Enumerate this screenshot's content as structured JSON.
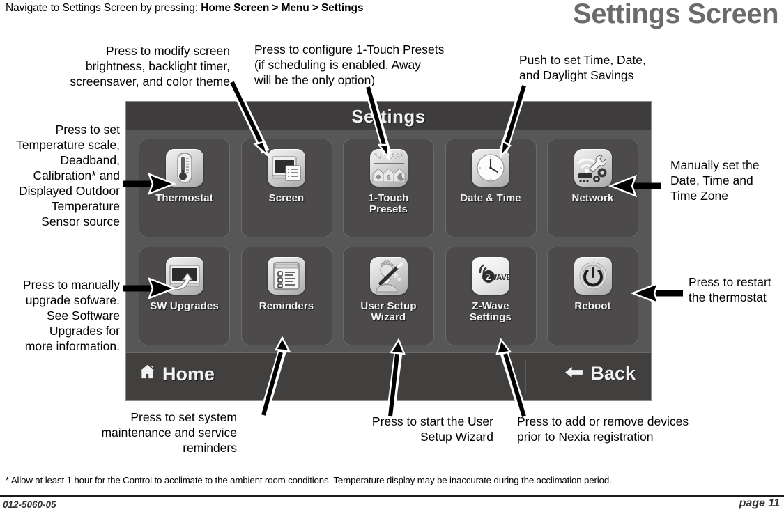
{
  "nav": {
    "prefix": "Navigate to Settings Screen by pressing:",
    "breadcrumb": "Home Screen > Menu > Settings"
  },
  "page": {
    "title": "Settings Screen",
    "footnote": "* Allow at least 1 hour for the Control to acclimate to the ambient room conditions.  Temperature display may be inaccurate during the acclimation period.",
    "doc_id": "012-5060-05",
    "page_number": "page 11"
  },
  "device": {
    "header_title": "Settings",
    "footer": {
      "home_label": "Home",
      "back_label": "Back",
      "home_icon": "home-icon",
      "back_icon": "arrow-left-icon"
    },
    "tiles": [
      {
        "id": "thermostat",
        "label": "Thermostat",
        "icon": "thermometer-icon"
      },
      {
        "id": "screen",
        "label": "Screen",
        "icon": "display-icon"
      },
      {
        "id": "one-touch",
        "label": "1-Touch\nPresets",
        "icon": "one-touch-presets-icon",
        "temp_high": "74°",
        "temp_low": "68°"
      },
      {
        "id": "date-time",
        "label": "Date & Time",
        "icon": "clock-icon"
      },
      {
        "id": "network",
        "label": "Network",
        "icon": "wifi-wrench-gear-icon"
      },
      {
        "id": "sw-upgrades",
        "label": "SW Upgrades",
        "icon": "screen-upload-arrow-icon"
      },
      {
        "id": "reminders",
        "label": "Reminders",
        "icon": "checklist-icon"
      },
      {
        "id": "user-wizard",
        "label": "User Setup\nWizard",
        "icon": "wizard-person-icon"
      },
      {
        "id": "z-wave",
        "label": "Z-Wave\nSettings",
        "icon": "z-wave-icon",
        "badge": "Z",
        "badge_text": "WAVE"
      },
      {
        "id": "reboot",
        "label": "Reboot",
        "icon": "power-icon"
      }
    ]
  },
  "callouts": [
    {
      "id": "screen",
      "text": "Press to modify screen\nbrightness, backlight timer,\nscreensaver, and color theme"
    },
    {
      "id": "one-touch",
      "text": "Press to configure 1-Touch Presets\n(if scheduling is enabled, Away\nwill be the only option)"
    },
    {
      "id": "date-time",
      "text": "Push to set Time, Date,\nand Daylight Savings"
    },
    {
      "id": "thermostat",
      "text": "Press to set\nTemperature  scale,\nDeadband,\nCalibration* and\nDisplayed Outdoor\nTemperature\nSensor source"
    },
    {
      "id": "network",
      "text": "Manually set the\nDate, Time and\nTime Zone"
    },
    {
      "id": "sw-upgrades",
      "text": "Press to manually\nupgrade sofware.\nSee Software\nUpgrades for\nmore information."
    },
    {
      "id": "reboot",
      "text": "Press to restart\nthe thermostat"
    },
    {
      "id": "reminders",
      "text": "Press to set system\nmaintenance and service\nreminders"
    },
    {
      "id": "user-wizard",
      "text": "Press to start the User\nSetup Wizard"
    },
    {
      "id": "z-wave",
      "text": "Press to add or remove devices\nprior to Nexia registration"
    }
  ],
  "colors": {
    "device_body": "#575757",
    "device_header": "#3e3c3c",
    "device_footer": "#423f3f",
    "tile_bg": "#4c4a4a",
    "title_gray": "#6b6b6b"
  }
}
